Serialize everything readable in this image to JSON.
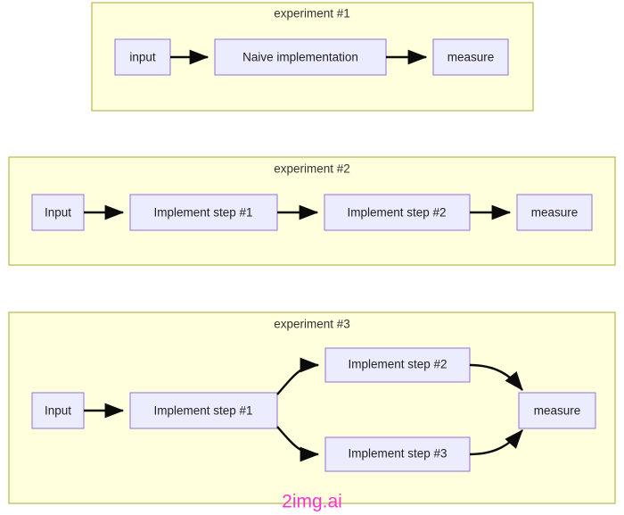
{
  "diagram": {
    "title_icon": "flowchart-icon",
    "background_color": "#ffffff",
    "group_fill": "#ffffdd",
    "group_stroke": "#aaaa33",
    "node_fill": "#ececff",
    "node_stroke": "#9370db",
    "edge_color": "#0b0b0b",
    "groups": [
      {
        "id": "experiment-1",
        "title": "experiment #1",
        "nodes": [
          {
            "id": "e1-input",
            "label": "input"
          },
          {
            "id": "e1-naive",
            "label": "Naive implementation"
          },
          {
            "id": "e1-measure",
            "label": "measure"
          }
        ],
        "edges": [
          {
            "from": "input",
            "to": "Naive implementation"
          },
          {
            "from": "Naive implementation",
            "to": "measure"
          }
        ]
      },
      {
        "id": "experiment-2",
        "title": "experiment #2",
        "nodes": [
          {
            "id": "e2-input",
            "label": "Input"
          },
          {
            "id": "e2-step1",
            "label": "Implement step #1"
          },
          {
            "id": "e2-step2",
            "label": "Implement step #2"
          },
          {
            "id": "e2-measure",
            "label": "measure"
          }
        ],
        "edges": [
          {
            "from": "Input",
            "to": "Implement step #1"
          },
          {
            "from": "Implement step #1",
            "to": "Implement step #2"
          },
          {
            "from": "Implement step #2",
            "to": "measure"
          }
        ]
      },
      {
        "id": "experiment-3",
        "title": "experiment #3",
        "nodes": [
          {
            "id": "e3-input",
            "label": "Input"
          },
          {
            "id": "e3-step1",
            "label": "Implement step #1"
          },
          {
            "id": "e3-step2",
            "label": "Implement step #2"
          },
          {
            "id": "e3-step3",
            "label": "Implement step #3"
          },
          {
            "id": "e3-measure",
            "label": "measure"
          }
        ],
        "edges": [
          {
            "from": "Input",
            "to": "Implement step #1"
          },
          {
            "from": "Implement step #1",
            "to": "Implement step #2"
          },
          {
            "from": "Implement step #1",
            "to": "Implement step #3"
          },
          {
            "from": "Implement step #2",
            "to": "measure"
          },
          {
            "from": "Implement step #3",
            "to": "measure"
          }
        ]
      }
    ]
  },
  "watermark": {
    "text": "2img.ai",
    "color": "#ff33cc"
  }
}
